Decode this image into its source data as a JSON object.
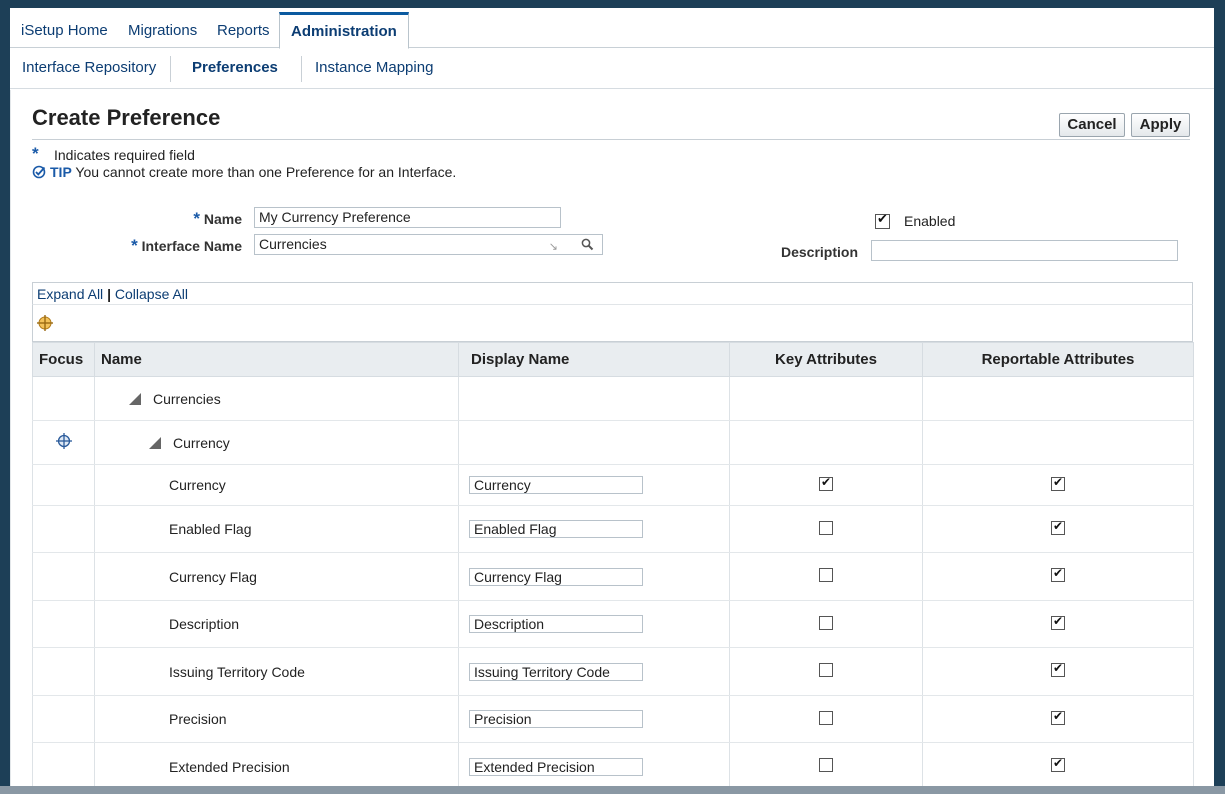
{
  "tabs": [
    {
      "label": "iSetup Home"
    },
    {
      "label": "Migrations"
    },
    {
      "label": "Reports"
    },
    {
      "label": "Administration",
      "active": true
    }
  ],
  "subnav": [
    {
      "label": "Interface Repository"
    },
    {
      "label": "Preferences",
      "active": true
    },
    {
      "label": "Instance Mapping"
    }
  ],
  "page": {
    "title": "Create Preference",
    "cancel_label": "Cancel",
    "apply_label": "Apply",
    "required_note": "Indicates required field",
    "tip_label": "TIP",
    "tip_text": " You cannot create more than one Preference for an Interface."
  },
  "form": {
    "name_label": "Name",
    "name_value": "My Currency Preference",
    "interface_label": "Interface Name",
    "interface_value": "Currencies",
    "enabled_label": "Enabled",
    "enabled_checked": true,
    "description_label": "Description",
    "description_value": ""
  },
  "tree": {
    "expand_all": "Expand All",
    "separator": "|",
    "collapse_all": "Collapse All"
  },
  "table": {
    "headers": [
      "Focus",
      "Name",
      "Display Name",
      "Key Attributes",
      "Reportable Attributes"
    ],
    "groups": [
      {
        "name": "Currencies"
      },
      {
        "name": "Currency"
      }
    ],
    "rows": [
      {
        "name": "Currency",
        "display": "Currency",
        "key": true,
        "reportable": true
      },
      {
        "name": "Enabled Flag",
        "display": "Enabled Flag",
        "key": false,
        "reportable": true
      },
      {
        "name": "Currency Flag",
        "display": "Currency Flag",
        "key": false,
        "reportable": true
      },
      {
        "name": "Description",
        "display": "Description",
        "key": false,
        "reportable": true
      },
      {
        "name": "Issuing Territory Code",
        "display": "Issuing Territory Code",
        "key": false,
        "reportable": true
      },
      {
        "name": "Precision",
        "display": "Precision",
        "key": false,
        "reportable": true
      },
      {
        "name": "Extended Precision",
        "display": "Extended Precision",
        "key": false,
        "reportable": true
      }
    ]
  },
  "colors": {
    "link": "#0c3d73",
    "accent": "#1a5aa8",
    "background": "#1d3f57"
  }
}
